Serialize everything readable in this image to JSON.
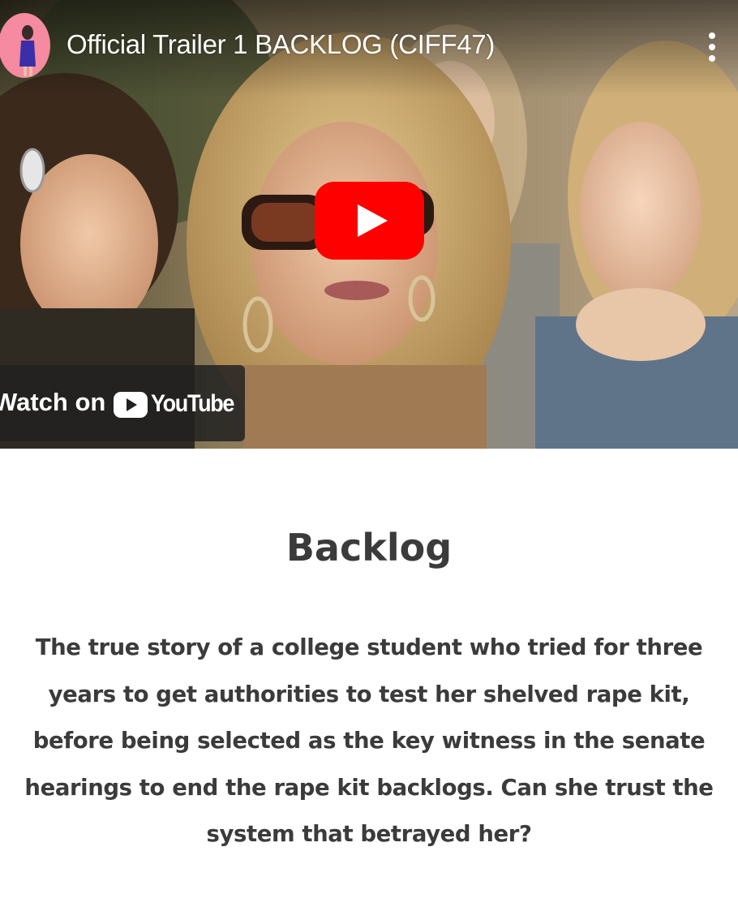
{
  "video": {
    "title": "Official Trailer 1 BACKLOG (CIFF47)",
    "more_icon": "vertical-ellipsis-icon",
    "play_icon": "youtube-play-icon",
    "watch_on_label": "Watch on",
    "youtube_wordmark": "YouTube",
    "colors": {
      "play_red": "#ff0000",
      "overlay": "#212121"
    }
  },
  "content": {
    "heading": "Backlog",
    "description": "The true story of a college student who tried for three years to get authorities to test her shelved rape kit, before being selected as the key witness in the senate hearings to end the rape kit backlogs. Can she trust the system that betrayed her?"
  }
}
